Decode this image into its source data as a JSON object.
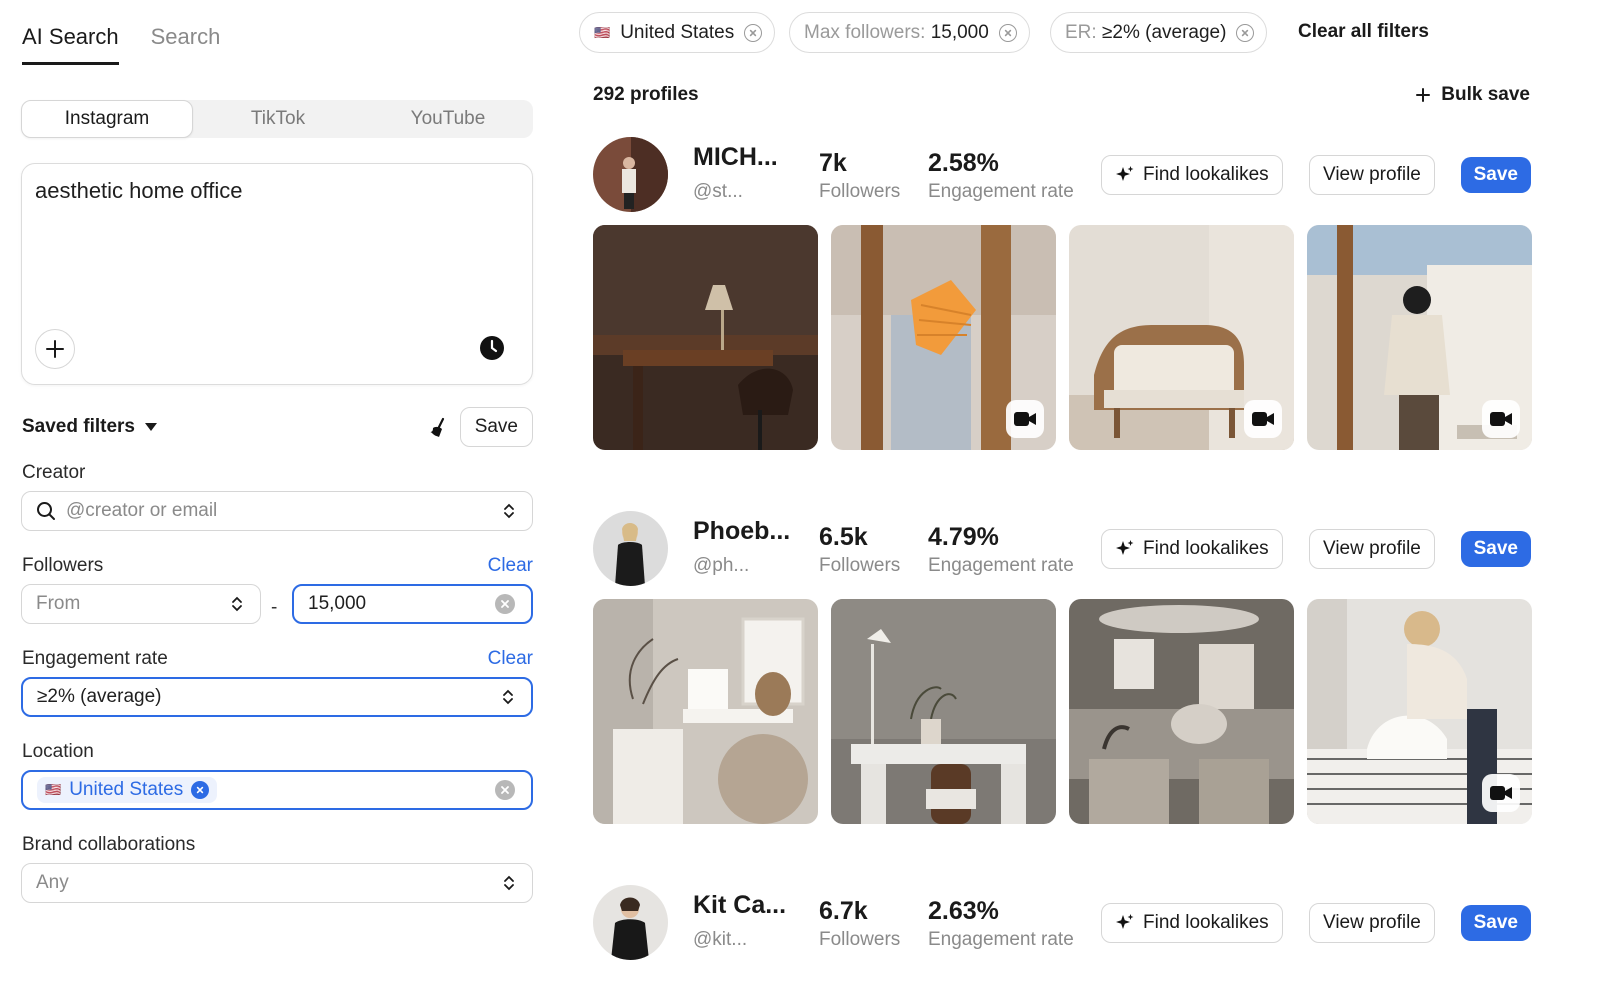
{
  "search_tabs": [
    "AI Search",
    "Search"
  ],
  "platforms": [
    "Instagram",
    "TikTok",
    "YouTube"
  ],
  "prompt": {
    "text": "aesthetic home office"
  },
  "saved_filters": {
    "label": "Saved filters",
    "save_label": "Save"
  },
  "creator": {
    "label": "Creator",
    "placeholder": "@creator or email"
  },
  "followers": {
    "label": "Followers",
    "clear": "Clear",
    "from_placeholder": "From",
    "dash": "-",
    "to_value": "15,000"
  },
  "engagement": {
    "label": "Engagement rate",
    "clear": "Clear",
    "value": "≥2% (average)"
  },
  "location": {
    "label": "Location",
    "chip": "United States",
    "flag": "🇺🇸"
  },
  "brand": {
    "label": "Brand collaborations",
    "placeholder": "Any"
  },
  "active_filters": {
    "country": {
      "flag": "🇺🇸",
      "value": "United States"
    },
    "max_followers": {
      "label": "Max followers:",
      "value": "15,000"
    },
    "er": {
      "label": "ER:",
      "value": "≥2% (average)"
    },
    "clear_all": "Clear all filters"
  },
  "results": {
    "count": "292 profiles",
    "bulk_save": "Bulk save"
  },
  "profile_buttons": {
    "lookalikes": "Find lookalikes",
    "view": "View profile",
    "save": "Save"
  },
  "profiles": [
    {
      "name": "MICH...",
      "handle": "@st...",
      "followers": "7k",
      "followers_label": "Followers",
      "er": "2.58%",
      "er_label": "Engagement rate"
    },
    {
      "name": "Phoeb...",
      "handle": "@ph...",
      "followers": "6.5k",
      "followers_label": "Followers",
      "er": "4.79%",
      "er_label": "Engagement rate"
    },
    {
      "name": "Kit Ca...",
      "handle": "@kit...",
      "followers": "6.7k",
      "followers_label": "Followers",
      "er": "2.63%",
      "er_label": "Engagement rate"
    }
  ],
  "colors": {
    "accent": "#2d6be4",
    "border": "#d6d6d6",
    "muted": "#8a8a8a"
  }
}
